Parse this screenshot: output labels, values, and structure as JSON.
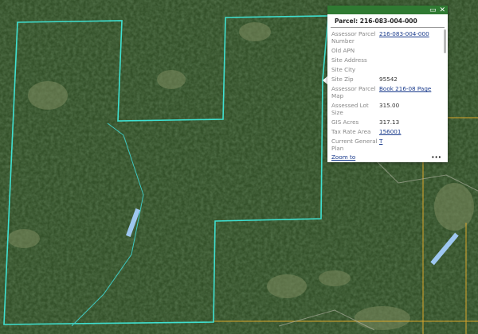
{
  "colors": {
    "parcel_boundary": "#3fe0d0",
    "parcel_lines": "#d9a52a",
    "popup_header": "#2f7a32",
    "link": "#1a3b8c"
  },
  "popup": {
    "title": "Parcel: 216-083-004-000",
    "icons": [
      "maximize-icon",
      "close-icon"
    ],
    "rows": [
      {
        "label": "Assessor Parcel Number",
        "value": "216-083-004-000",
        "link": true
      },
      {
        "label": "Old APN",
        "value": ""
      },
      {
        "label": "Site Address",
        "value": ""
      },
      {
        "label": "Site City",
        "value": ""
      },
      {
        "label": "Site Zip",
        "value": "95542"
      },
      {
        "label": "Assessor Parcel Map",
        "value": "Book 216-08 Page",
        "link": true
      },
      {
        "label": "Assessed Lot Size",
        "value": "315.00"
      },
      {
        "label": "GIS Acres",
        "value": "317.13"
      },
      {
        "label": "Tax Rate Area",
        "value": "156001",
        "link": true
      },
      {
        "label": "Current General Plan",
        "value": "T",
        "link": true
      }
    ],
    "zoom_to": "Zoom to",
    "more": "•••"
  }
}
